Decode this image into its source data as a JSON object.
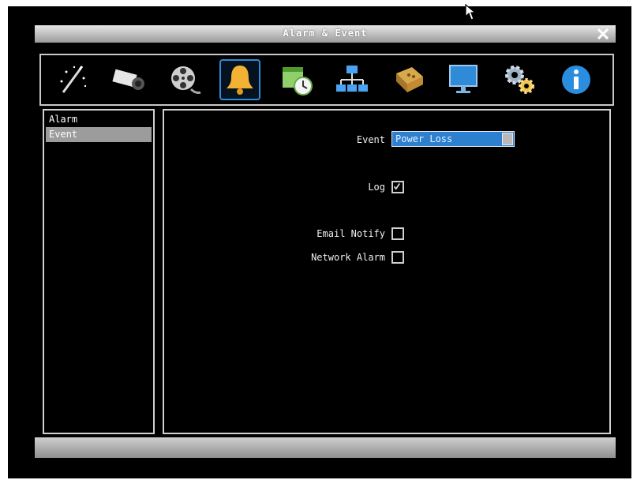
{
  "window": {
    "title": "Alarm & Event"
  },
  "toolbar": {
    "icons": [
      {
        "name": "wizard-icon"
      },
      {
        "name": "camera-icon"
      },
      {
        "name": "film-reel-icon"
      },
      {
        "name": "bell-icon",
        "active": true
      },
      {
        "name": "schedule-icon"
      },
      {
        "name": "network-icon"
      },
      {
        "name": "storage-icon"
      },
      {
        "name": "monitor-icon"
      },
      {
        "name": "gears-icon"
      },
      {
        "name": "info-icon"
      }
    ]
  },
  "sidebar": {
    "items": [
      {
        "label": "Alarm",
        "selected": false
      },
      {
        "label": "Event",
        "selected": true
      }
    ]
  },
  "form": {
    "event_label": "Event",
    "event_value": "Power Loss",
    "log_label": "Log",
    "log_checked": true,
    "email_label": "Email Notify",
    "email_checked": false,
    "network_alarm_label": "Network Alarm",
    "network_alarm_checked": false
  },
  "colors": {
    "accent": "#2d7fd0",
    "titlebar": "#b0b0b0",
    "selected_item": "#9c9c9c"
  }
}
